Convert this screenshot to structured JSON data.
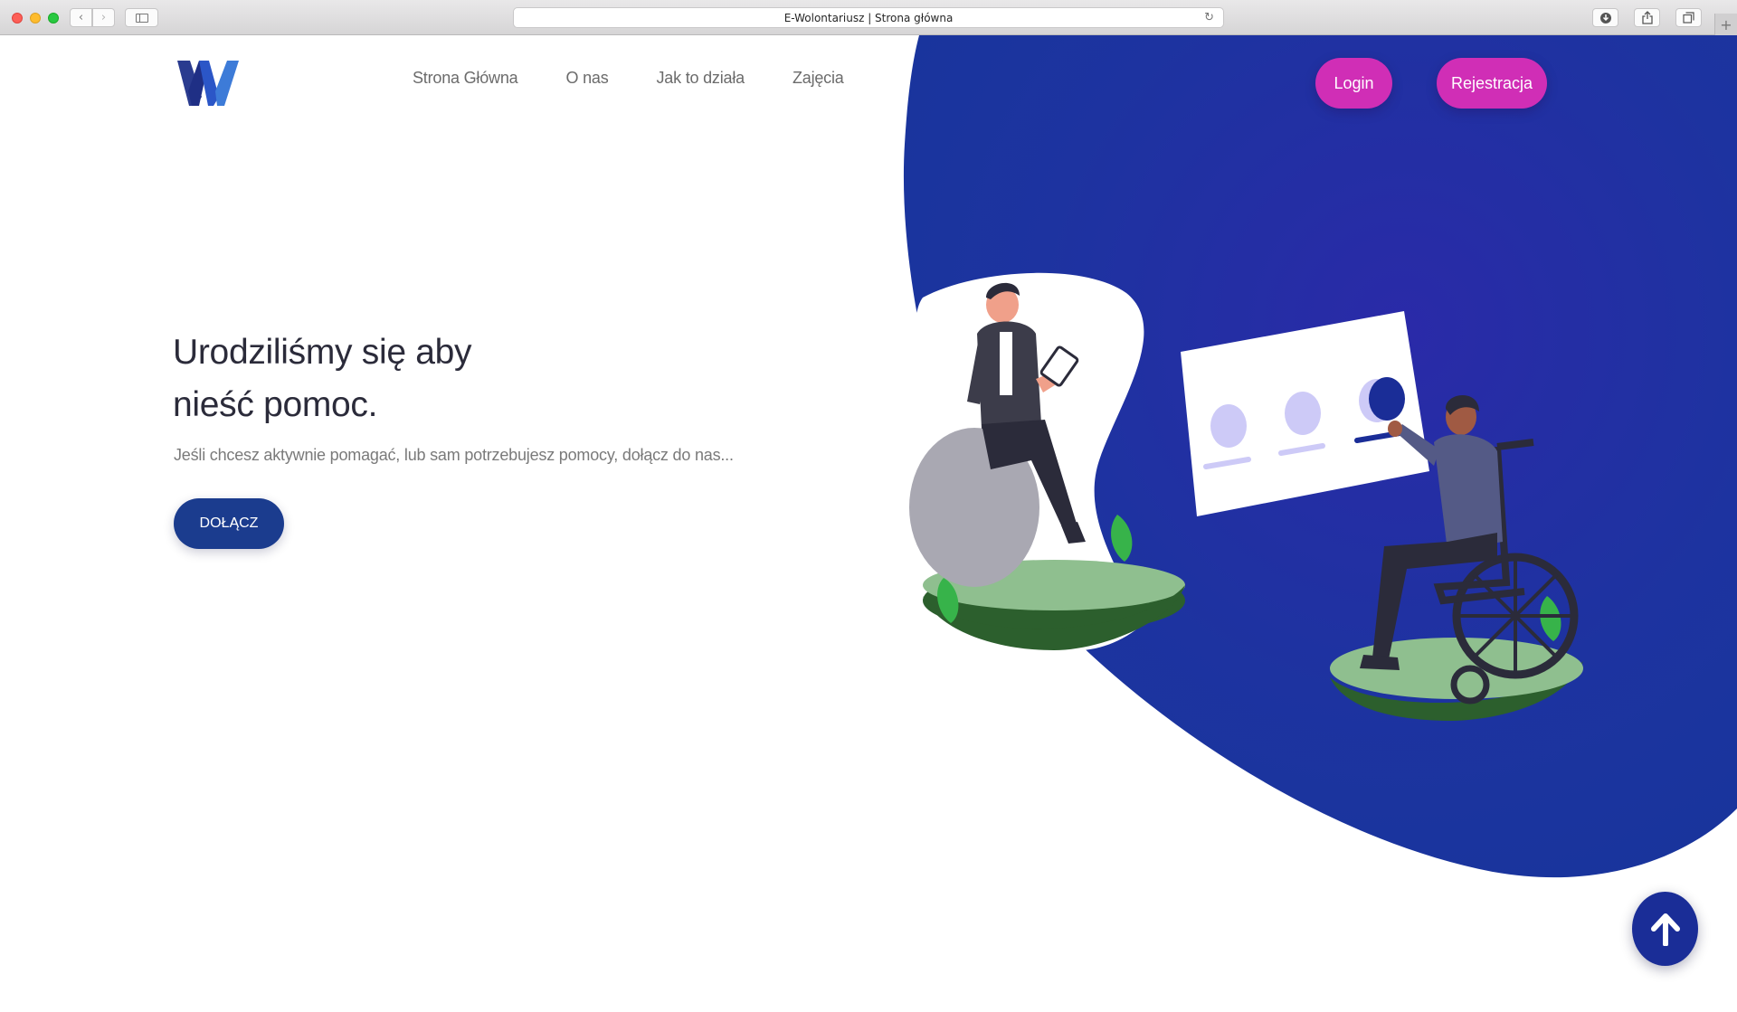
{
  "browser": {
    "page_title": "E-Wolontariusz | Strona główna",
    "back_icon": "chevron-left-icon",
    "forward_icon": "chevron-right-icon",
    "sidebar_icon": "sidebar-icon",
    "reload_icon": "reload-icon",
    "download_icon": "download-icon",
    "share_icon": "share-icon",
    "tabs_icon": "tabs-icon",
    "newtab_icon": "plus-icon"
  },
  "header": {
    "logo_icon": "w-logo-icon",
    "nav": [
      {
        "label": "Strona Główna"
      },
      {
        "label": "O nas"
      },
      {
        "label": "Jak to działa"
      },
      {
        "label": "Zajęcia"
      }
    ],
    "login_label": "Login",
    "register_label": "Rejestracja"
  },
  "hero": {
    "title_line1": "Urodziliśmy się aby",
    "title_line2": "nieść pomoc.",
    "subtitle": "Jeśli chcesz aktywnie pomagać, lub sam potrzebujesz pomocy, dołącz do nas...",
    "cta_label": "DOŁĄCZ"
  },
  "scroll_top_icon": "arrow-up-icon",
  "colors": {
    "brand_blue": "#1a2d97",
    "accent_pink": "#d02eb6",
    "cta_blue": "#1b3c8e",
    "text_dark": "#2b2b3a",
    "text_muted": "#7a7a7a"
  }
}
